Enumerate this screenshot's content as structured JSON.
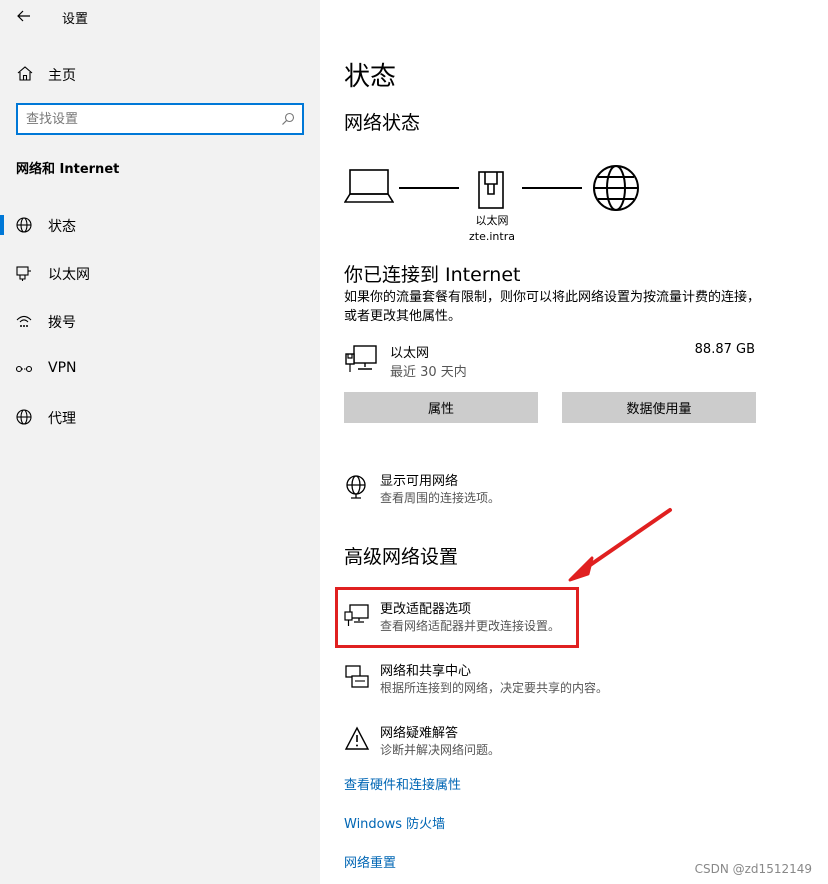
{
  "window": {
    "title": "设置",
    "back_icon": "back-arrow-icon"
  },
  "sidebar": {
    "home": {
      "label": "主页",
      "icon": "home-icon"
    },
    "search": {
      "placeholder": "查找设置",
      "value": "",
      "icon": "search-icon"
    },
    "section_title": "网络和 Internet",
    "items": [
      {
        "label": "状态",
        "icon": "globe-status-icon",
        "active": true
      },
      {
        "label": "以太网",
        "icon": "ethernet-icon",
        "active": false
      },
      {
        "label": "拨号",
        "icon": "dialup-icon",
        "active": false
      },
      {
        "label": "VPN",
        "icon": "vpn-icon",
        "active": false
      },
      {
        "label": "代理",
        "icon": "globe-proxy-icon",
        "active": false
      }
    ]
  },
  "main": {
    "title": "状态",
    "network_status_heading": "网络状态",
    "diagram": {
      "adapter_name": "以太网",
      "adapter_host": "zte.intra"
    },
    "connected_heading": "你已连接到 Internet",
    "connected_desc": "如果你的流量套餐有限制，则你可以将此网络设置为按流量计费的连接，或者更改其他属性。",
    "usage": {
      "name": "以太网",
      "period": "最近 30 天内",
      "amount": "88.87 GB",
      "icon": "ethernet-monitor-icon"
    },
    "buttons": {
      "properties": "属性",
      "data_usage": "数据使用量"
    },
    "show_networks": {
      "title": "显示可用网络",
      "subtitle": "查看周围的连接选项。",
      "icon": "globe-network-icon"
    },
    "advanced_heading": "高级网络设置",
    "advanced": [
      {
        "title": "更改适配器选项",
        "subtitle": "查看网络适配器并更改连接设置。",
        "icon": "adapter-monitor-icon"
      },
      {
        "title": "网络和共享中心",
        "subtitle": "根据所连接到的网络，决定要共享的内容。",
        "icon": "sharing-center-icon"
      },
      {
        "title": "网络疑难解答",
        "subtitle": "诊断并解决网络问题。",
        "icon": "warning-icon"
      }
    ],
    "links": {
      "hardware": "查看硬件和连接属性",
      "firewall": "Windows 防火墙",
      "reset": "网络重置"
    }
  },
  "colors": {
    "accent": "#0078d7",
    "link": "#0066b4",
    "highlight": "#e02020",
    "sidebar_bg": "#f2f2f2",
    "button_bg": "#cccccc"
  },
  "watermark": "CSDN @zd1512149"
}
